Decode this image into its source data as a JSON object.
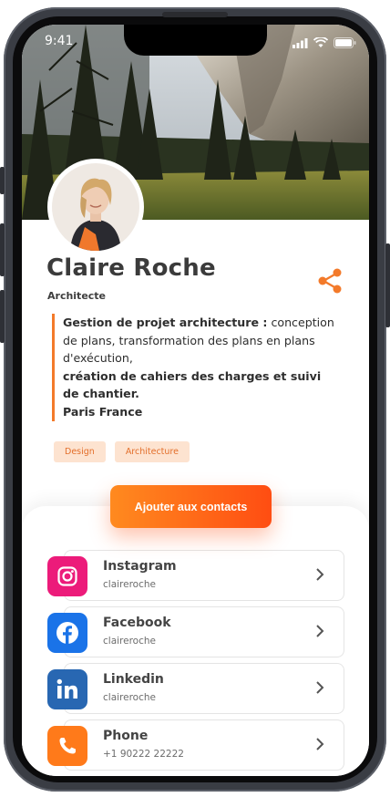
{
  "status": {
    "time": "9:41"
  },
  "profile": {
    "name": "Claire Roche",
    "title": "Architecte",
    "bio": {
      "line1_bold": "Gestion de projet architecture :",
      "line1_rest": " conception de plans, transformation des plans en plans d'exécution,",
      "line2_bold": "création de cahiers des charges et suivi de chantier.",
      "line3_bold": "Paris France"
    },
    "tags": [
      "Design",
      "Architecture"
    ]
  },
  "actions": {
    "add_contact_label": "Ajouter aux contacts"
  },
  "links": [
    {
      "title": "Instagram",
      "subtitle": "claireroche",
      "icon": "instagram-icon",
      "color": "#ec1b7a"
    },
    {
      "title": "Facebook",
      "subtitle": "claireroche",
      "icon": "facebook-icon",
      "color": "#1a73e8"
    },
    {
      "title": "Linkedin",
      "subtitle": "claireroche",
      "icon": "linkedin-icon",
      "color": "#2867b2"
    },
    {
      "title": "Phone",
      "subtitle": "+1 90222 22222",
      "icon": "phone-icon",
      "color": "#ff7a1a"
    }
  ],
  "colors": {
    "accent": "#f37a2a",
    "tag_bg": "#fde3d0"
  }
}
